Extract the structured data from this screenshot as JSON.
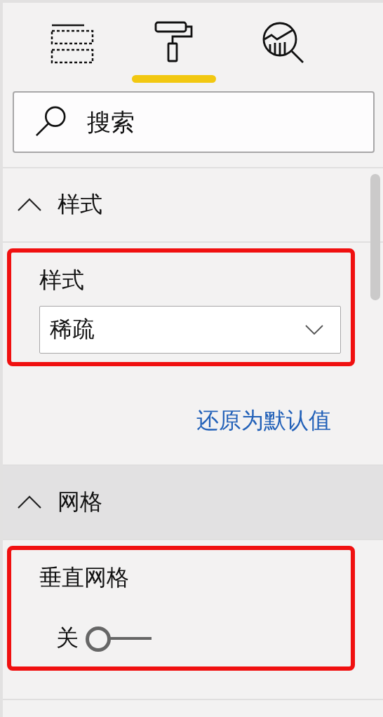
{
  "tabs": [
    {
      "kind": "fields",
      "selected": false
    },
    {
      "kind": "format",
      "selected": true
    },
    {
      "kind": "analytics",
      "selected": false
    }
  ],
  "search": {
    "placeholder": "搜索"
  },
  "sections": [
    {
      "title": "样式",
      "expanded": true,
      "hovered": false,
      "highlighted": true,
      "label": "样式",
      "kind": "dropdown",
      "value": "稀疏",
      "reset": "还原为默认值"
    },
    {
      "title": "网格",
      "expanded": true,
      "hovered": true,
      "highlighted": true,
      "label": "垂直网格",
      "kind": "toggle",
      "on": false,
      "state_text": "关"
    }
  ]
}
